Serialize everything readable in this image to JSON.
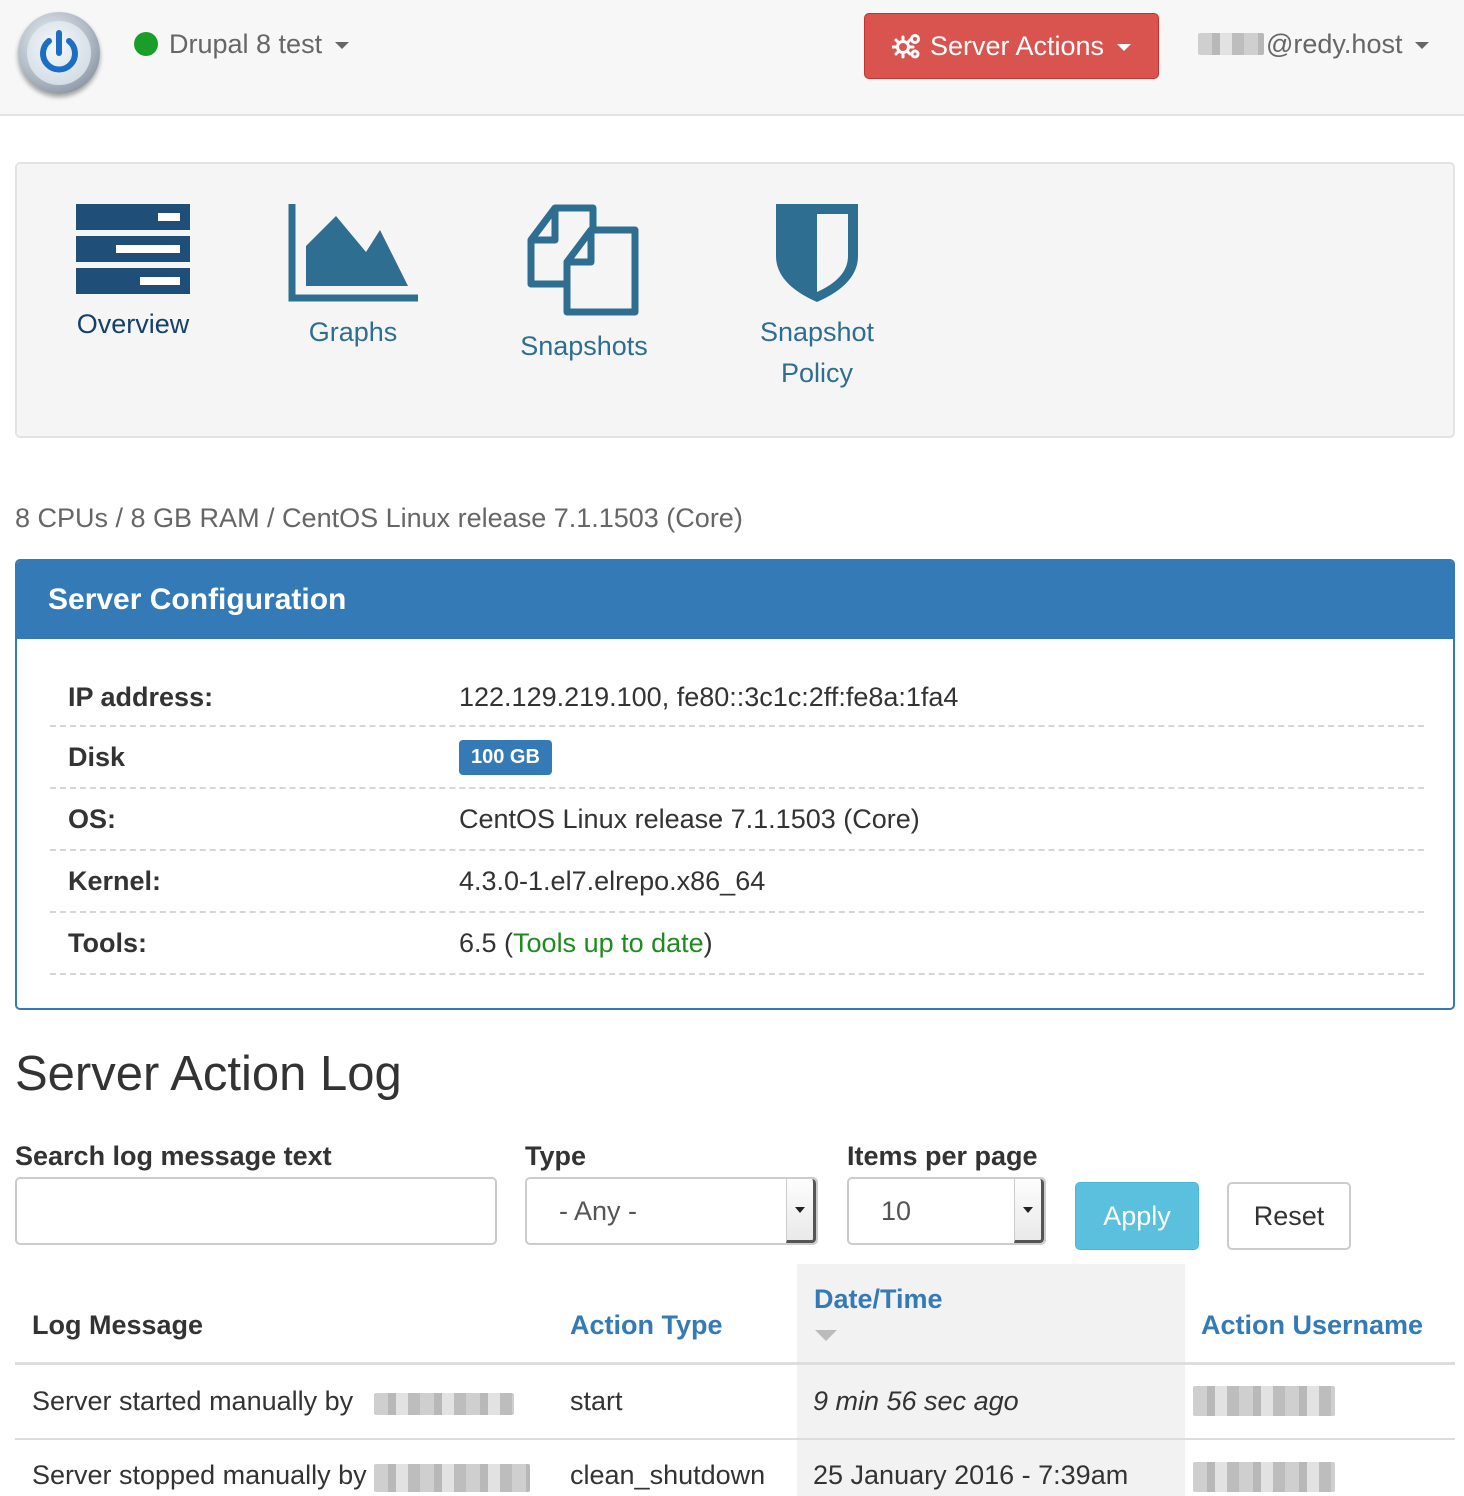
{
  "header": {
    "server_name": "Drupal 8 test",
    "server_status_color": "#1a9e2a",
    "server_actions_label": "Server Actions",
    "user_suffix": "@redy.host",
    "icons": {
      "logo": "power-icon",
      "actions": "gears-icon"
    }
  },
  "nav": {
    "tiles": [
      {
        "label": "Overview",
        "icon": "server-list-icon",
        "active": true
      },
      {
        "label": "Graphs",
        "icon": "area-chart-icon"
      },
      {
        "label": "Snapshots",
        "icon": "copy-files-icon"
      },
      {
        "label": "Snapshot Policy",
        "icon": "shield-icon"
      }
    ],
    "tile_color": "#1f4e79",
    "link_color": "#2e6e90"
  },
  "specs": "8 CPUs / 8 GB RAM / CentOS Linux release 7.1.1503 (Core)",
  "config": {
    "title": "Server Configuration",
    "rows": [
      {
        "label": "IP address:",
        "value": "122.129.219.100, fe80::3c1c:2ff:fe8a:1fa4"
      },
      {
        "label": "Disk",
        "value": "100 GB"
      },
      {
        "label": "OS:",
        "value": "CentOS Linux release 7.1.1503 (Core)"
      },
      {
        "label": "Kernel:",
        "value": "4.3.0-1.el7.elrepo.x86_64"
      },
      {
        "label": "Tools:",
        "value_prefix": "6.5 (",
        "value_status": "Tools up to date",
        "value_suffix": ")"
      }
    ],
    "accent": "#337ab7"
  },
  "log": {
    "title": "Server Action Log",
    "filters": {
      "search_label": "Search log message text",
      "search_value": "",
      "type_label": "Type",
      "type_value": "- Any -",
      "items_label": "Items per page",
      "items_value": "10",
      "apply_label": "Apply",
      "reset_label": "Reset"
    },
    "columns": [
      "Log Message",
      "Action Type",
      "Date/Time",
      "Action Username"
    ],
    "rows": [
      {
        "message": "Server started manually by",
        "type": "start",
        "datetime": "9 min 56 sec ago"
      },
      {
        "message": "Server stopped manually by",
        "type": "clean_shutdown",
        "datetime": "25 January 2016 - 7:39am"
      }
    ]
  }
}
